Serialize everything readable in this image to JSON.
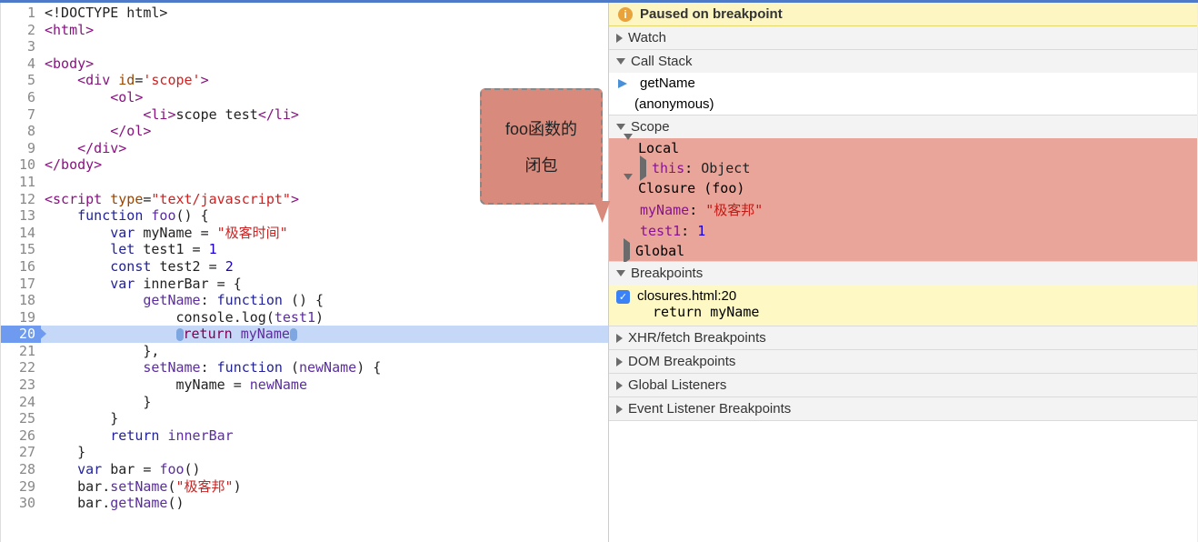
{
  "editor": {
    "lines": [
      {
        "n": 1,
        "dim": true,
        "tokens": [
          {
            "t": "<!DOCTYPE html>",
            "c": "c-pl"
          }
        ]
      },
      {
        "n": 2,
        "tokens": [
          {
            "t": "<html>",
            "c": "c-tag"
          }
        ]
      },
      {
        "n": 3,
        "tokens": []
      },
      {
        "n": 4,
        "tokens": [
          {
            "t": "<body>",
            "c": "c-tag"
          }
        ]
      },
      {
        "n": 5,
        "tokens": [
          {
            "t": "    ",
            "c": "tok-sp"
          },
          {
            "t": "<div ",
            "c": "c-tag"
          },
          {
            "t": "id",
            "c": "c-attr"
          },
          {
            "t": "=",
            "c": "c-pl"
          },
          {
            "t": "'scope'",
            "c": "c-str"
          },
          {
            "t": ">",
            "c": "c-tag"
          }
        ]
      },
      {
        "n": 6,
        "tokens": [
          {
            "t": "        ",
            "c": "tok-sp"
          },
          {
            "t": "<ol>",
            "c": "c-tag"
          }
        ]
      },
      {
        "n": 7,
        "tokens": [
          {
            "t": "            ",
            "c": "tok-sp"
          },
          {
            "t": "<li>",
            "c": "c-tag"
          },
          {
            "t": "scope test",
            "c": "c-pl"
          },
          {
            "t": "</li>",
            "c": "c-tag"
          }
        ]
      },
      {
        "n": 8,
        "tokens": [
          {
            "t": "        ",
            "c": "tok-sp"
          },
          {
            "t": "</ol>",
            "c": "c-tag"
          }
        ]
      },
      {
        "n": 9,
        "tokens": [
          {
            "t": "    ",
            "c": "tok-sp"
          },
          {
            "t": "</div>",
            "c": "c-tag"
          }
        ]
      },
      {
        "n": 10,
        "tokens": [
          {
            "t": "</body>",
            "c": "c-tag"
          }
        ]
      },
      {
        "n": 11,
        "tokens": []
      },
      {
        "n": 12,
        "tokens": [
          {
            "t": "<script ",
            "c": "c-tag"
          },
          {
            "t": "type",
            "c": "c-attr"
          },
          {
            "t": "=",
            "c": "c-pl"
          },
          {
            "t": "\"text/javascript\"",
            "c": "c-str"
          },
          {
            "t": ">",
            "c": "c-tag"
          }
        ]
      },
      {
        "n": 13,
        "tokens": [
          {
            "t": "    ",
            "c": "tok-sp"
          },
          {
            "t": "function ",
            "c": "c-kw"
          },
          {
            "t": "foo",
            "c": "c-id"
          },
          {
            "t": "() {",
            "c": "c-pl"
          }
        ]
      },
      {
        "n": 14,
        "tokens": [
          {
            "t": "        ",
            "c": "tok-sp"
          },
          {
            "t": "var ",
            "c": "c-kw"
          },
          {
            "t": "myName",
            "c": "c-pl"
          },
          {
            "t": " = ",
            "c": "c-pl"
          },
          {
            "t": "\"极客时间\"",
            "c": "c-str"
          }
        ]
      },
      {
        "n": 15,
        "tokens": [
          {
            "t": "        ",
            "c": "tok-sp"
          },
          {
            "t": "let ",
            "c": "c-kw"
          },
          {
            "t": "test1",
            "c": "c-pl"
          },
          {
            "t": " = ",
            "c": "c-pl"
          },
          {
            "t": "1",
            "c": "c-num"
          }
        ]
      },
      {
        "n": 16,
        "tokens": [
          {
            "t": "        ",
            "c": "tok-sp"
          },
          {
            "t": "const ",
            "c": "c-kw"
          },
          {
            "t": "test2",
            "c": "c-pl"
          },
          {
            "t": " = ",
            "c": "c-pl"
          },
          {
            "t": "2",
            "c": "c-num"
          }
        ]
      },
      {
        "n": 17,
        "tokens": [
          {
            "t": "        ",
            "c": "tok-sp"
          },
          {
            "t": "var ",
            "c": "c-kw"
          },
          {
            "t": "innerBar",
            "c": "c-pl"
          },
          {
            "t": " = {",
            "c": "c-pl"
          }
        ]
      },
      {
        "n": 18,
        "tokens": [
          {
            "t": "            ",
            "c": "tok-sp"
          },
          {
            "t": "getName",
            "c": "c-id"
          },
          {
            "t": ": ",
            "c": "c-pl"
          },
          {
            "t": "function ",
            "c": "c-kw"
          },
          {
            "t": "() {",
            "c": "c-pl"
          }
        ]
      },
      {
        "n": 19,
        "tokens": [
          {
            "t": "                ",
            "c": "tok-sp"
          },
          {
            "t": "console",
            "c": "c-pl"
          },
          {
            "t": ".",
            "c": "c-pl"
          },
          {
            "t": "log",
            "c": "c-pl"
          },
          {
            "t": "(",
            "c": "c-pl"
          },
          {
            "t": "test1",
            "c": "c-id"
          },
          {
            "t": ")",
            "c": "c-pl"
          }
        ]
      },
      {
        "n": 20,
        "hl": true,
        "tokens": [
          {
            "t": "                ",
            "c": "tok-sp"
          },
          {
            "pill": true
          },
          {
            "t": "return ",
            "c": "c-fn"
          },
          {
            "t": "myName",
            "c": "c-id"
          },
          {
            "pill": true
          }
        ]
      },
      {
        "n": 21,
        "tokens": [
          {
            "t": "            ",
            "c": "tok-sp"
          },
          {
            "t": "},",
            "c": "c-pl"
          }
        ]
      },
      {
        "n": 22,
        "tokens": [
          {
            "t": "            ",
            "c": "tok-sp"
          },
          {
            "t": "setName",
            "c": "c-id"
          },
          {
            "t": ": ",
            "c": "c-pl"
          },
          {
            "t": "function ",
            "c": "c-kw"
          },
          {
            "t": "(",
            "c": "c-pl"
          },
          {
            "t": "newName",
            "c": "c-id"
          },
          {
            "t": ") {",
            "c": "c-pl"
          }
        ]
      },
      {
        "n": 23,
        "tokens": [
          {
            "t": "                ",
            "c": "tok-sp"
          },
          {
            "t": "myName",
            "c": "c-pl"
          },
          {
            "t": " = ",
            "c": "c-pl"
          },
          {
            "t": "newName",
            "c": "c-id"
          }
        ]
      },
      {
        "n": 24,
        "tokens": [
          {
            "t": "            ",
            "c": "tok-sp"
          },
          {
            "t": "}",
            "c": "c-pl"
          }
        ]
      },
      {
        "n": 25,
        "tokens": [
          {
            "t": "        ",
            "c": "tok-sp"
          },
          {
            "t": "}",
            "c": "c-pl"
          }
        ]
      },
      {
        "n": 26,
        "tokens": [
          {
            "t": "        ",
            "c": "tok-sp"
          },
          {
            "t": "return ",
            "c": "c-kw"
          },
          {
            "t": "innerBar",
            "c": "c-id"
          }
        ]
      },
      {
        "n": 27,
        "tokens": [
          {
            "t": "    ",
            "c": "tok-sp"
          },
          {
            "t": "}",
            "c": "c-pl"
          }
        ]
      },
      {
        "n": 28,
        "tokens": [
          {
            "t": "    ",
            "c": "tok-sp"
          },
          {
            "t": "var ",
            "c": "c-kw"
          },
          {
            "t": "bar",
            "c": "c-pl"
          },
          {
            "t": " = ",
            "c": "c-pl"
          },
          {
            "t": "foo",
            "c": "c-id"
          },
          {
            "t": "()",
            "c": "c-pl"
          }
        ]
      },
      {
        "n": 29,
        "tokens": [
          {
            "t": "    ",
            "c": "tok-sp"
          },
          {
            "t": "bar",
            "c": "c-pl"
          },
          {
            "t": ".",
            "c": "c-pl"
          },
          {
            "t": "setName",
            "c": "c-id"
          },
          {
            "t": "(",
            "c": "c-pl"
          },
          {
            "t": "\"极客邦\"",
            "c": "c-str"
          },
          {
            "t": ")",
            "c": "c-pl"
          }
        ]
      },
      {
        "n": 30,
        "tokens": [
          {
            "t": "    ",
            "c": "tok-sp"
          },
          {
            "t": "bar",
            "c": "c-pl"
          },
          {
            "t": ".",
            "c": "c-pl"
          },
          {
            "t": "getName",
            "c": "c-id"
          },
          {
            "t": "()",
            "c": "c-pl"
          }
        ]
      }
    ]
  },
  "callout": {
    "line1": "foo函数的",
    "line2": "闭包"
  },
  "sidebar": {
    "banner": "Paused on breakpoint",
    "watch": {
      "title": "Watch"
    },
    "callstack": {
      "title": "Call Stack",
      "frames": [
        {
          "name": "getName",
          "current": true
        },
        {
          "name": "(anonymous)",
          "current": false
        }
      ]
    },
    "scope": {
      "title": "Scope",
      "groups": [
        {
          "name": "Local",
          "expanded": true,
          "hl": true,
          "props": [
            {
              "name": "this",
              "sep": ": ",
              "val": "Object",
              "vc": "prop-val-obj",
              "arrow": true
            }
          ]
        },
        {
          "name": "Closure (foo)",
          "expanded": true,
          "hl": true,
          "props": [
            {
              "name": "myName",
              "sep": ": ",
              "val": "\"极客邦\"",
              "vc": "prop-val-str"
            },
            {
              "name": "test1",
              "sep": ": ",
              "val": "1",
              "vc": "prop-val-num"
            }
          ]
        },
        {
          "name": "Global",
          "expanded": false,
          "hl": true,
          "props": []
        }
      ]
    },
    "breakpoints": {
      "title": "Breakpoints",
      "items": [
        {
          "file": "closures.html:20",
          "snippet": "return myName",
          "checked": true
        }
      ]
    },
    "xhr": {
      "title": "XHR/fetch Breakpoints"
    },
    "dom": {
      "title": "DOM Breakpoints"
    },
    "listeners": {
      "title": "Global Listeners"
    },
    "evlisteners": {
      "title": "Event Listener Breakpoints"
    }
  }
}
